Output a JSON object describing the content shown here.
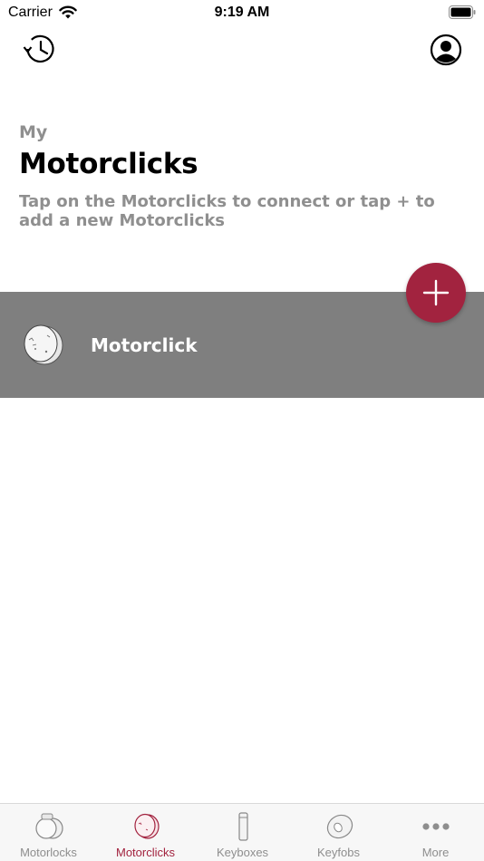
{
  "status_bar": {
    "carrier": "Carrier",
    "time": "9:19 AM"
  },
  "header": {
    "kicker": "My",
    "title": "Motorclicks",
    "subtitle": "Tap on the Motorclicks to connect or tap + to add a new Motorclicks"
  },
  "devices": [
    {
      "name": "Motorclick"
    }
  ],
  "fab": {
    "icon": "plus-icon"
  },
  "colors": {
    "accent": "#a2233f",
    "row_bg": "#7f7f7f",
    "muted_text": "#8f8f8f"
  },
  "tabs": [
    {
      "label": "Motorlocks",
      "icon": "motorlock-icon",
      "active": false
    },
    {
      "label": "Motorclicks",
      "icon": "motorclick-icon",
      "active": true
    },
    {
      "label": "Keyboxes",
      "icon": "keybox-icon",
      "active": false
    },
    {
      "label": "Keyfobs",
      "icon": "keyfob-icon",
      "active": false
    },
    {
      "label": "More",
      "icon": "more-icon",
      "active": false
    }
  ]
}
